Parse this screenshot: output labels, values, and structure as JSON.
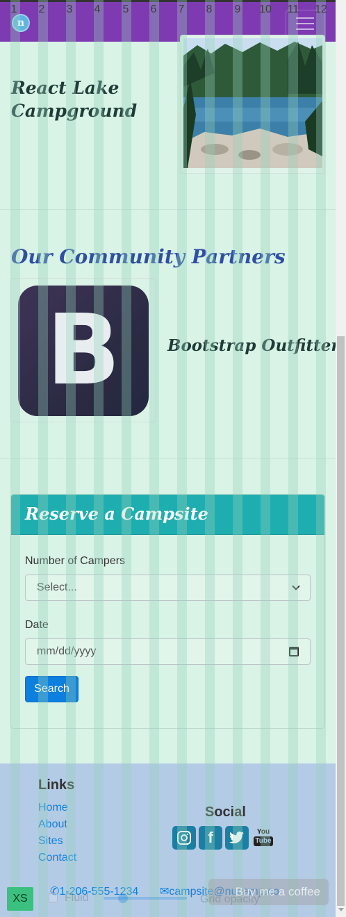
{
  "navbar": {
    "logo_letter": "n",
    "toggler_label": "Toggle navigation"
  },
  "grid_helper": {
    "columns": [
      "1",
      "2",
      "3",
      "4",
      "5",
      "6",
      "7",
      "8",
      "9",
      "10",
      "11",
      "12"
    ],
    "breakpoint": "XS",
    "fluid_label": "Fluid",
    "opacity_label": "Grid opacity",
    "coffee_label": "Buy me a coffee"
  },
  "campground": {
    "title": "React Lake Campground"
  },
  "partners": {
    "heading": "Our Community Partners",
    "partner_logo_letter": "B",
    "partner_name": "Bootstrap Outfitters"
  },
  "reserve": {
    "title": "Reserve a Campsite",
    "campers_label": "Number of Campers",
    "campers_value": "Select...",
    "date_label": "Date",
    "date_placeholder": "mm/dd/yyyy",
    "search_label": "Search"
  },
  "footer": {
    "links_heading": "Links",
    "links": [
      "Home",
      "About",
      "Sites",
      "Contact"
    ],
    "social_heading": "Social",
    "social_icons": [
      "instagram-icon",
      "facebook-icon",
      "twitter-icon",
      "youtube-icon"
    ],
    "phone": "1-206-555-1234",
    "email": "campsite@nucamp.co"
  },
  "colors": {
    "navbar": "#7e3ab1",
    "page_bg": "#d9f3e6",
    "card_header": "#1faeb0",
    "primary": "#0d7fde",
    "footer_bg": "#b4cbe6",
    "partners_heading": "#2f4fa4"
  }
}
